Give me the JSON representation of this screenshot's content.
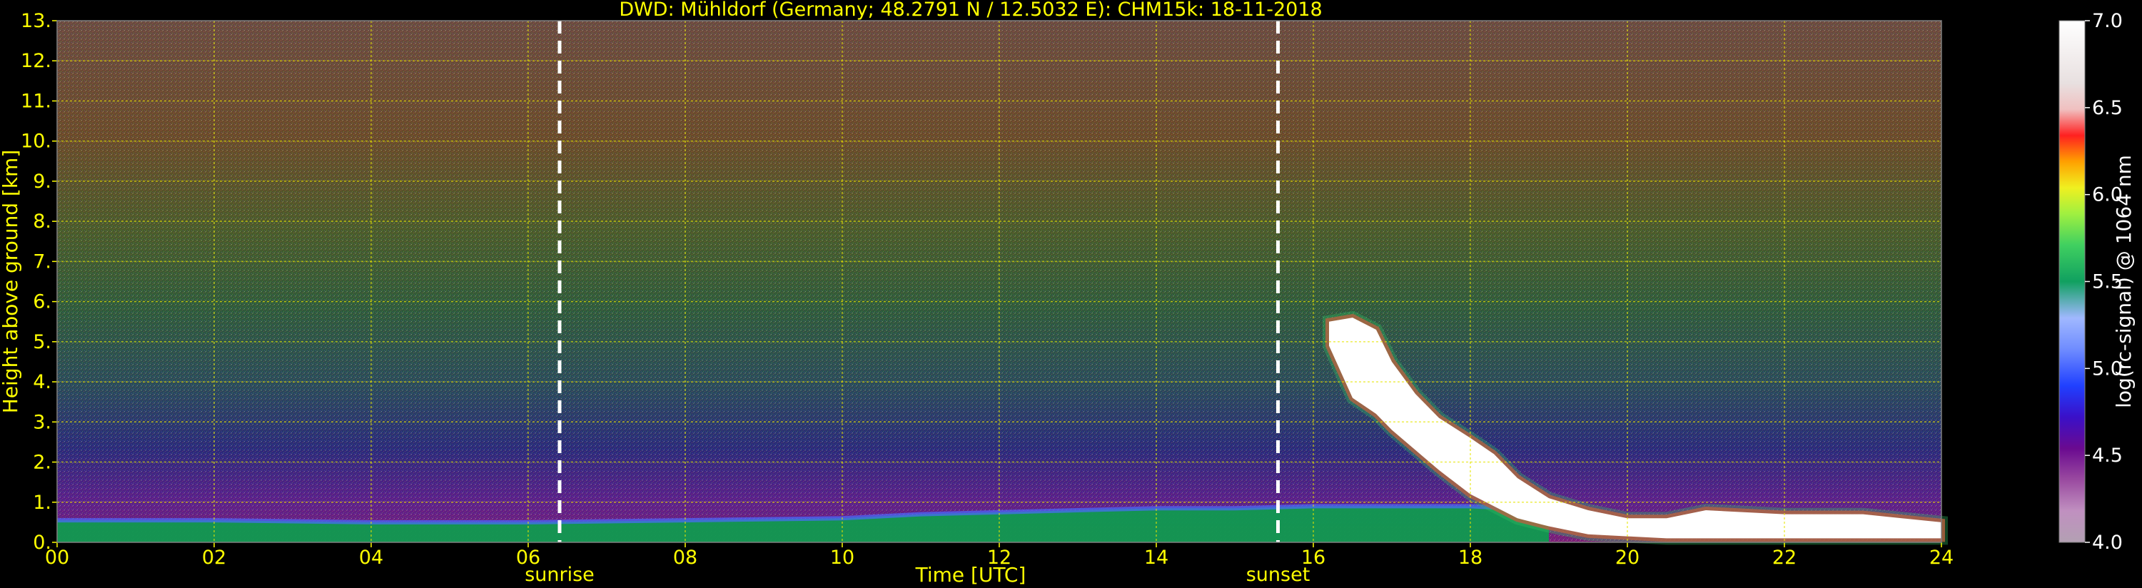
{
  "chart_data": {
    "type": "heatmap",
    "title": "DWD: Mühldorf (Germany; 48.2791 N / 12.5032 E):    CHM15k: 18-11-2018",
    "xlabel": "Time [UTC]",
    "ylabel": "Height above ground [km]",
    "xlim": [
      0,
      24
    ],
    "ylim": [
      0,
      13
    ],
    "x_ticks": [
      "00",
      "02",
      "04",
      "06",
      "08",
      "10",
      "12",
      "14",
      "16",
      "18",
      "20",
      "22",
      "24"
    ],
    "y_ticks": [
      "0.",
      "1.",
      "2.",
      "3.",
      "4.",
      "5.",
      "6.",
      "7.",
      "8.",
      "9.",
      "10.",
      "11.",
      "12.",
      "13."
    ],
    "grid": true,
    "colorbar": {
      "label": "log(rc-signal) @ 1064 nm",
      "range": [
        4.0,
        7.0
      ],
      "ticks": [
        "4.0",
        "4.5",
        "5.0",
        "5.5",
        "6.0",
        "6.5",
        "7.0"
      ]
    },
    "annotations": [
      {
        "label": "sunrise",
        "x": 6.4
      },
      {
        "label": "sunset",
        "x": 15.55
      }
    ],
    "boundary_layer": {
      "x": [
        0,
        2,
        4,
        6,
        8,
        10,
        11,
        12,
        13,
        14,
        15,
        16,
        17,
        18,
        19
      ],
      "top_km": [
        0.55,
        0.55,
        0.5,
        0.5,
        0.55,
        0.6,
        0.7,
        0.75,
        0.8,
        0.85,
        0.85,
        0.9,
        0.9,
        0.9,
        0.8
      ]
    },
    "cloud_layers": [
      {
        "x": [
          16.2,
          16.5,
          16.8,
          17.0,
          17.3,
          17.6,
          18.0,
          18.3,
          18.6,
          19.0,
          19.5,
          20.0,
          20.5,
          21.0,
          22.0,
          23.0,
          24.0
        ],
        "base_km": [
          4.9,
          3.6,
          3.2,
          2.8,
          2.3,
          1.8,
          1.2,
          0.9,
          0.6,
          0.4,
          0.2,
          0.15,
          0.1,
          0.1,
          0.1,
          0.1,
          0.1
        ],
        "top_km": [
          5.5,
          5.6,
          5.3,
          4.5,
          3.7,
          3.1,
          2.6,
          2.2,
          1.6,
          1.1,
          0.8,
          0.6,
          0.6,
          0.8,
          0.7,
          0.7,
          0.5
        ]
      }
    ]
  }
}
